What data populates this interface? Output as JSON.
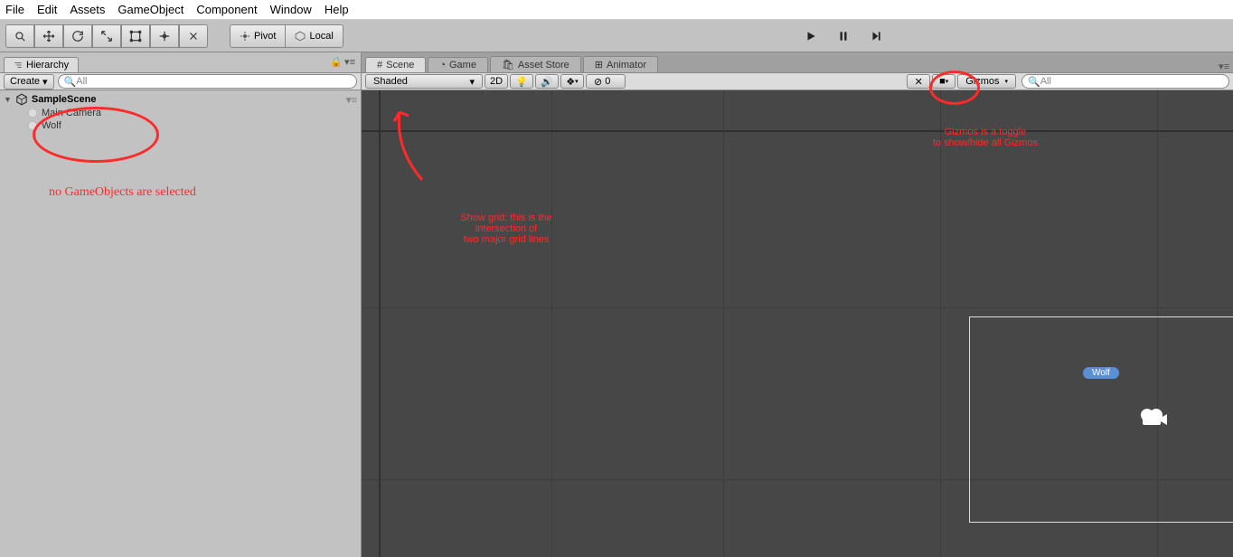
{
  "menu": {
    "items": [
      "File",
      "Edit",
      "Assets",
      "GameObject",
      "Component",
      "Window",
      "Help"
    ]
  },
  "toolbar": {
    "pivot": "Pivot",
    "local": "Local"
  },
  "hierarchy": {
    "tab": "Hierarchy",
    "create": "Create",
    "search_placeholder": "All",
    "scene": "SampleScene",
    "objects": [
      "Main Camera",
      "Wolf"
    ]
  },
  "sceneTabs": {
    "scene": "Scene",
    "game": "Game",
    "assetStore": "Asset Store",
    "animator": "Animator"
  },
  "sceneToolbar": {
    "shading": "Shaded",
    "twoD": "2D",
    "gizmos": "Gizmos",
    "search_placeholder": "All",
    "zero": "0"
  },
  "viewport": {
    "wolfLabel": "Wolf"
  },
  "annotations": {
    "noSelect": "no GameObjects are selected",
    "grid1": "Show grid: this is the",
    "grid2": "intersection of",
    "grid3": "two major grid lines",
    "giz1": "Gizmos is a toggle",
    "giz2": "to show/hide all Gizmos"
  }
}
